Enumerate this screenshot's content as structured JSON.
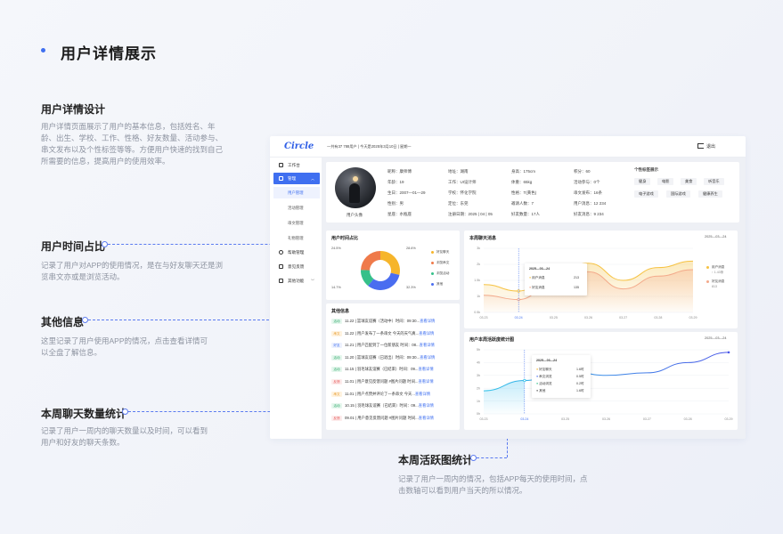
{
  "page": {
    "title": "用户详情展示",
    "accent": "#3f6ff0"
  },
  "annotations": [
    {
      "title": "用户详情设计",
      "desc": "用户详情页面展示了用户的基本信息，包括姓名、年龄、出生、学校、工作、性格、好友数量、活动参与、串文发布以及个性标签等等。方便用户快速的找到自己所需要的信息，提高用户的使用效率。"
    },
    {
      "title": "用户时间占比",
      "desc": "记录了用户对APP的使用情况，是在与好友聊天还是浏览串文亦或是浏览活动。"
    },
    {
      "title": "其他信息",
      "desc": "这里记录了用户使用APP的情况，点击查看详情可以全盘了解信息。"
    },
    {
      "title": "本周聊天数量统计",
      "desc": "记录了用户一周内的聊天数量以及时间，可以看到用户和好友的聊天条数。"
    },
    {
      "title": "本周活跃图统计",
      "desc": "记录了用户一周内的情况，包括APP每天的使用时间，点击数轴可以看到用户当天的所以情况。"
    }
  ],
  "app": {
    "logo": "Circle",
    "topinfo": "一共有37 788用户 | 今天是2025年3月10日 | 星期一",
    "logout": "退出",
    "nav": [
      {
        "label": "工作台"
      },
      {
        "label": "管理"
      },
      {
        "label": "帮助管理"
      },
      {
        "label": "意见反馈"
      },
      {
        "label": "其他功能"
      }
    ],
    "subnav": [
      "用户管理",
      "活动管理",
      "串文管理",
      "礼物管理"
    ],
    "profile": {
      "avatar_label": "用户头像",
      "fields": [
        [
          "昵称：康师傅",
          "地址：湖南",
          "身高：175cm",
          "积分：60"
        ],
        [
          "年龄：19",
          "工作：UI设计师",
          "体重：65kg",
          "活动参与：0个"
        ],
        [
          "生日：2007—01—29",
          "学校：怀化学院",
          "性格：T(黄色)",
          "串文发布：16条"
        ],
        [
          "性别：男",
          "定位：东莞",
          "邀请人数：7",
          "用户消息：12 234"
        ],
        [
          "星座：水瓶座",
          "注册日期：2025 | 04 | 05",
          "好友数量：17人",
          "好友消息：9 234"
        ]
      ],
      "tags_title": "个性标签展示",
      "tags": [
        "健身",
        "电影",
        "美食",
        "听音乐",
        "电子游戏",
        "国际游戏",
        "健康养生"
      ]
    },
    "time_ratio": {
      "title": "用户时间占比",
      "legend": [
        "好友聊天",
        "浏览串文",
        "浏览活动",
        "其他"
      ],
      "percents": [
        "24.5%",
        "28.6%",
        "14.7%",
        "32.3%"
      ]
    },
    "other_info": {
      "title": "其他信息",
      "rows": [
        {
          "tag": "活动",
          "text": "11.22 | 篮球友谊赛（活动中）时间：09:30...",
          "link": "查看详情"
        },
        {
          "tag": "串文",
          "text": "11.22 | 用户发布了一条串文 今天的天气真...",
          "link": "查看详情"
        },
        {
          "tag": "好友",
          "text": "11.21 | 用户匹配到了一位新朋友 时间：08...",
          "link": "查看详情"
        },
        {
          "tag": "活动",
          "text": "11.20 | 篮球友谊赛（已退出）时间：09:30...",
          "link": "查看详情"
        },
        {
          "tag": "活动",
          "text": "11.15 | 羽毛球友谊赛（已结束）时间：09...",
          "link": "查看详情"
        },
        {
          "tag": "反馈",
          "text": "11.01 | 用户意见反馈问题 #图片问题 时间...",
          "link": "查看详情"
        },
        {
          "tag": "串文",
          "text": "11.01 | 用户点赞并评论了一条串文 今天...",
          "link": "查看详情"
        },
        {
          "tag": "活动",
          "text": "10.15 | 羽毛球友谊赛（已结束）时间：09...",
          "link": "查看详情"
        },
        {
          "tag": "反馈",
          "text": "09.01 | 用户意见反馈问题 #图片问题 时间...",
          "link": "查看详情"
        }
      ]
    },
    "chat_chart": {
      "title": "本周聊天消息",
      "date": "2025—03—24",
      "yticks": [
        "3k",
        "2k",
        "1.5k",
        "1k",
        "0.5k"
      ],
      "xticks": [
        "03.23",
        "03.24",
        "03.25",
        "03.26",
        "03.27",
        "03.28",
        "03.29"
      ],
      "tooltip": {
        "date": "2025—03—24",
        "rows": [
          [
            "用户消息",
            "213"
          ],
          [
            "好友消息",
            "135"
          ]
        ]
      },
      "legend": [
        {
          "name": "用户消息",
          "sub": "↑ 1.43条"
        },
        {
          "name": "好友消息",
          "sub": "813"
        }
      ]
    },
    "active_chart": {
      "title": "用户本周活跃度统计图",
      "date": "2025—03—24",
      "yticks": [
        "5h",
        "4h",
        "3h",
        "2h",
        "1h",
        "0h"
      ],
      "xticks": [
        "03.23",
        "03.24",
        "03.25",
        "03.26",
        "03.27",
        "03.28",
        "03.29"
      ],
      "tooltip": {
        "date": "2025—03—24",
        "rows": [
          [
            "好友聊天",
            "1.6时"
          ],
          [
            "串文浏览",
            "0.5时"
          ],
          [
            "活动浏览",
            "0.2时"
          ],
          [
            "其他",
            "1.6时"
          ]
        ]
      }
    }
  },
  "chart_data": [
    {
      "type": "pie",
      "title": "用户时间占比",
      "categories": [
        "好友聊天",
        "浏览串文",
        "浏览活动",
        "其他"
      ],
      "values": [
        28.6,
        32.3,
        14.7,
        24.5
      ],
      "colors": [
        "#f6b52b",
        "#4a6df0",
        "#36c08a",
        "#ef7a4a"
      ]
    },
    {
      "type": "area",
      "title": "本周聊天消息",
      "categories": [
        "03.23",
        "03.24",
        "03.25",
        "03.26",
        "03.27",
        "03.28",
        "03.29"
      ],
      "series": [
        {
          "name": "用户消息",
          "values": [
            1.3,
            1.0,
            1.8,
            2.3,
            1.5,
            2.1,
            2.4
          ],
          "color": "#f6c242"
        },
        {
          "name": "好友消息",
          "values": [
            0.8,
            0.6,
            1.4,
            1.9,
            1.1,
            1.7,
            2.0
          ],
          "color": "#f3a98a"
        }
      ],
      "ylim": [
        0,
        3
      ]
    },
    {
      "type": "line",
      "title": "用户本周活跃度统计图",
      "categories": [
        "03.23",
        "03.24",
        "03.25",
        "03.26",
        "03.27",
        "03.28",
        "03.29"
      ],
      "series": [
        {
          "name": "",
          "values": [
            1.8,
            2.6,
            3.4,
            3.0,
            3.2,
            4.0,
            4.8
          ],
          "color": "#4a8cf0"
        }
      ],
      "ylim": [
        0,
        5
      ]
    }
  ]
}
